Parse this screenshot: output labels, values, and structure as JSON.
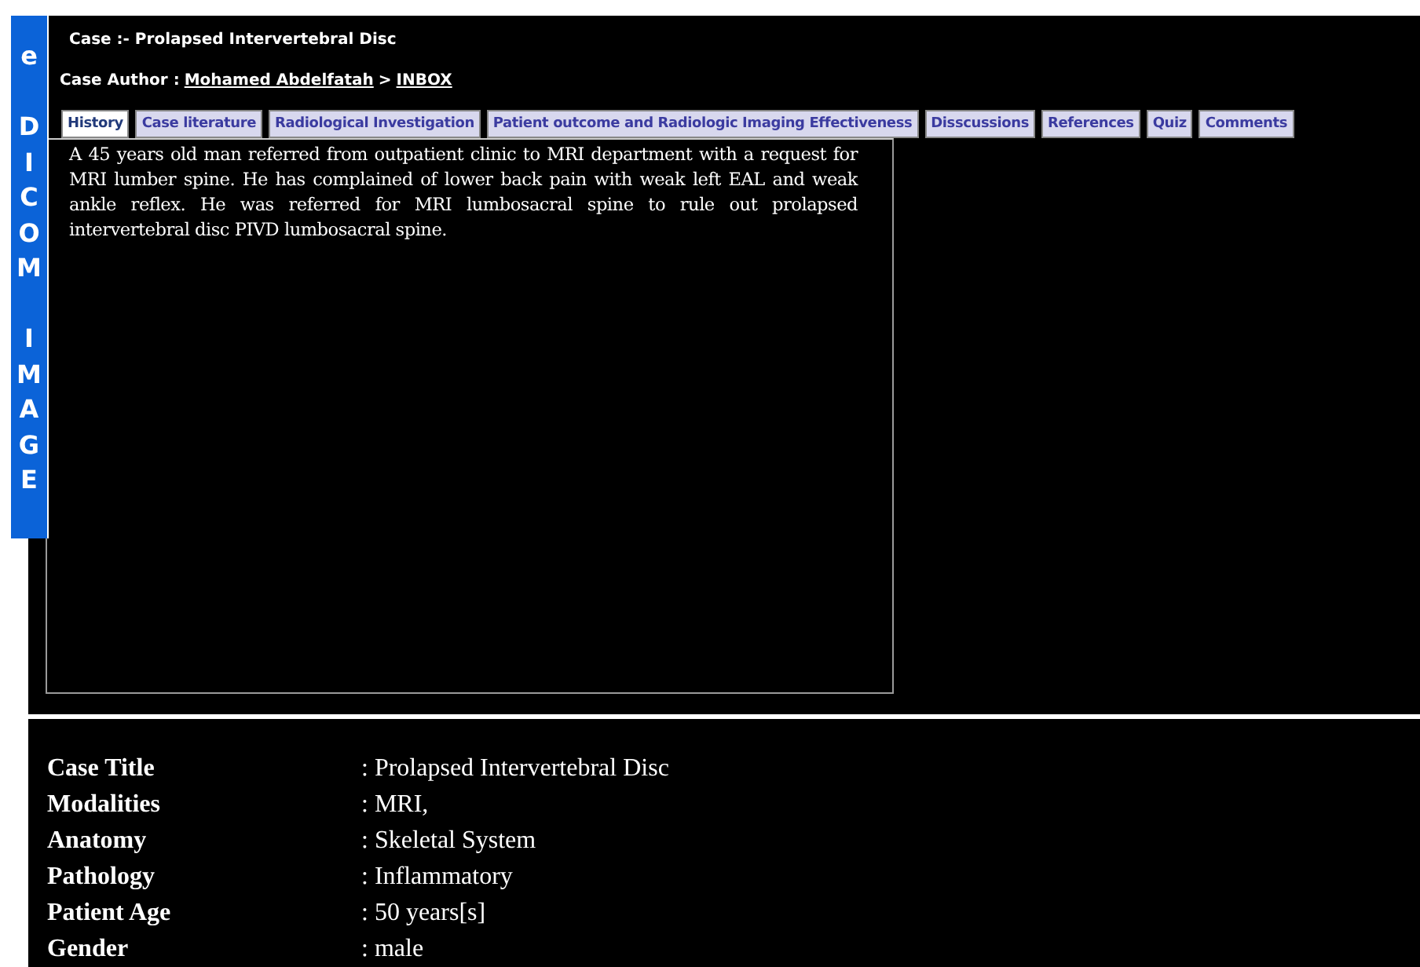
{
  "side_tab": {
    "text": "e DICOM IMAGE"
  },
  "header": {
    "case_title": "Case :- Prolapsed Intervertebral Disc",
    "author_label": "Case Author :",
    "author_link": "Mohamed Abdelfatah",
    "separator": ">",
    "inbox_link": "INBOX"
  },
  "tabs": [
    {
      "label": "History",
      "selected": true
    },
    {
      "label": "Case literature",
      "selected": false
    },
    {
      "label": "Radiological Investigation",
      "selected": false
    },
    {
      "label": "Patient outcome and Radiologic Imaging Effectiveness",
      "selected": false
    },
    {
      "label": "Disscussions",
      "selected": false
    },
    {
      "label": "References",
      "selected": false
    },
    {
      "label": "Quiz",
      "selected": false
    },
    {
      "label": "Comments",
      "selected": false
    }
  ],
  "history_text": "A 45 years old man referred from outpatient clinic to MRI department with a request for MRI lumber spine. He has complained of lower back pain with weak left EAL and weak ankle reflex. He was referred for MRI lumbosacral spine to rule out prolapsed intervertebral disc PIVD lumbosacral spine.",
  "details": [
    {
      "label": "Case Title",
      "value": ": Prolapsed Intervertebral Disc"
    },
    {
      "label": "Modalities",
      "value": ": MRI,"
    },
    {
      "label": "Anatomy",
      "value": ": Skeletal System"
    },
    {
      "label": "Pathology",
      "value": ": Inflammatory"
    },
    {
      "label": "Patient Age",
      "value": ": 50 years[s]"
    },
    {
      "label": "Gender",
      "value": ": male"
    }
  ]
}
